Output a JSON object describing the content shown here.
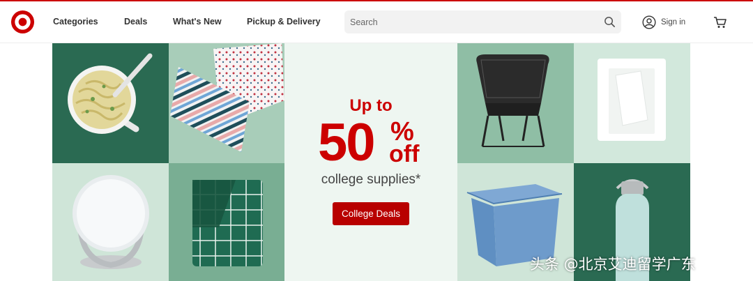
{
  "header": {
    "logo": "target-bullseye-logo",
    "nav": [
      "Categories",
      "Deals",
      "What's New",
      "Pickup & Delivery"
    ],
    "search_placeholder": "Search",
    "sign_in": "Sign in"
  },
  "hero": {
    "headline_top": "Up to",
    "discount_number": "50",
    "discount_percent": "%",
    "discount_off": "off",
    "subhead": "college supplies*",
    "cta": "College Deals",
    "tiles": [
      "noodle-bowl",
      "striped-pillows",
      "vanity-mirror",
      "green-plaid-bedding",
      "black-lounge-chair",
      "white-sheet-set",
      "blue-storage-bin",
      "water-bottle"
    ]
  },
  "watermark": "头条 @北京艾迪留学广东",
  "colors": {
    "brand_red": "#cc0000",
    "button_red": "#b80000",
    "dark_green": "#2a6a52"
  }
}
